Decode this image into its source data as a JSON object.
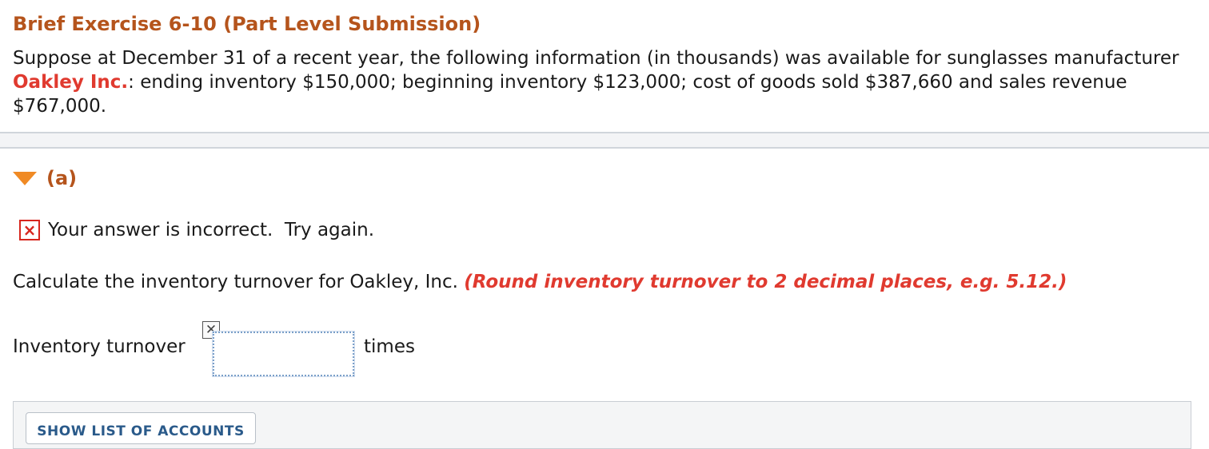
{
  "exercise": {
    "title": "Brief Exercise 6-10 (Part Level Submission)",
    "intro_before_company": "Suppose at December 31 of a recent year, the following information (in thousands) was available for sunglasses manufacturer ",
    "company_name": "Oakley Inc.",
    "intro_after_company": ": ending inventory $150,000; beginning inventory $123,000; cost of goods sold $387,660 and sales revenue $767,000."
  },
  "part": {
    "label": "(a)",
    "expanded": true,
    "toggle_icon": "caret-down-icon"
  },
  "feedback": {
    "icon": "incorrect-x-icon",
    "icon_glyph": "×",
    "message": "Your answer is incorrect.  Try again."
  },
  "question": {
    "prompt": "Calculate the inventory turnover for Oakley, Inc. ",
    "hint": "(Round inventory turnover to 2 decimal places, e.g. 5.12.)"
  },
  "answer": {
    "label": "Inventory turnover",
    "value": "",
    "flag_icon": "incorrect-mark-icon",
    "flag_glyph": "✕",
    "unit": "times"
  },
  "accounts": {
    "button_label": "SHOW LIST OF ACCOUNTS"
  },
  "colors": {
    "heading": "#b5541c",
    "highlight_red": "#e03a2f",
    "error_red": "#d7261e",
    "caret": "#f08a24",
    "link_blue": "#2a5a8a"
  }
}
